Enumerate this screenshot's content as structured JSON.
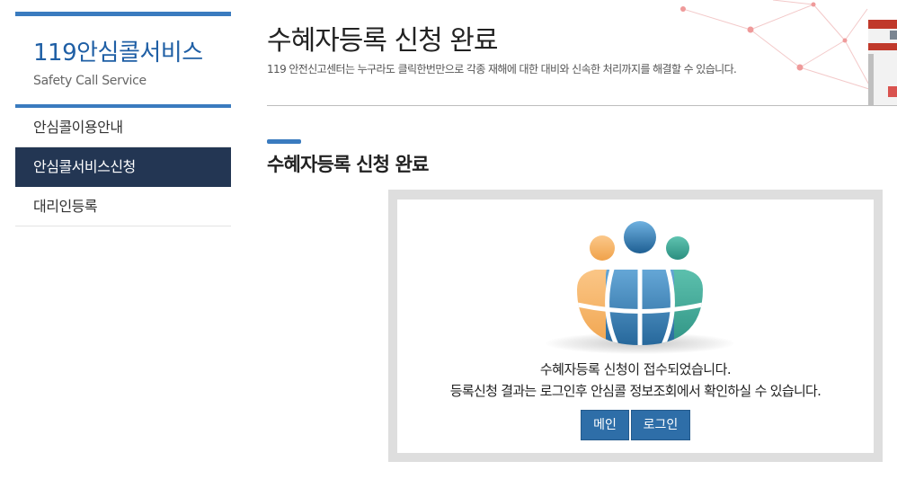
{
  "sidebar": {
    "brand_title": "119안심콜서비스",
    "brand_subtitle": "Safety Call Service",
    "items": [
      {
        "label": "안심콜이용안내",
        "active": false
      },
      {
        "label": "안심콜서비스신청",
        "active": true
      },
      {
        "label": "대리인등록",
        "active": false
      }
    ]
  },
  "header": {
    "title": "수혜자등록 신청 완료",
    "description": "119 안전신고센터는 누구라도 클릭한번만으로 각종 재해에 대한 대비와 신속한 처리까지를 해결할 수 있습니다."
  },
  "section": {
    "title": "수혜자등록 신청 완료"
  },
  "result": {
    "message_line1": "수혜자등록 신청이 접수되었습니다.",
    "message_line2": "등록신청 결과는 로그인후 안심콜 정보조회에서 확인하실 수 있습니다.",
    "main_button": "메인",
    "login_button": "로그인"
  },
  "colors": {
    "accent": "#3a7bbf",
    "sidebar_active": "#233653",
    "button": "#2e6ea8",
    "frame": "#dedede"
  },
  "icons": [
    "people-globe-illustration",
    "network-decoration"
  ]
}
